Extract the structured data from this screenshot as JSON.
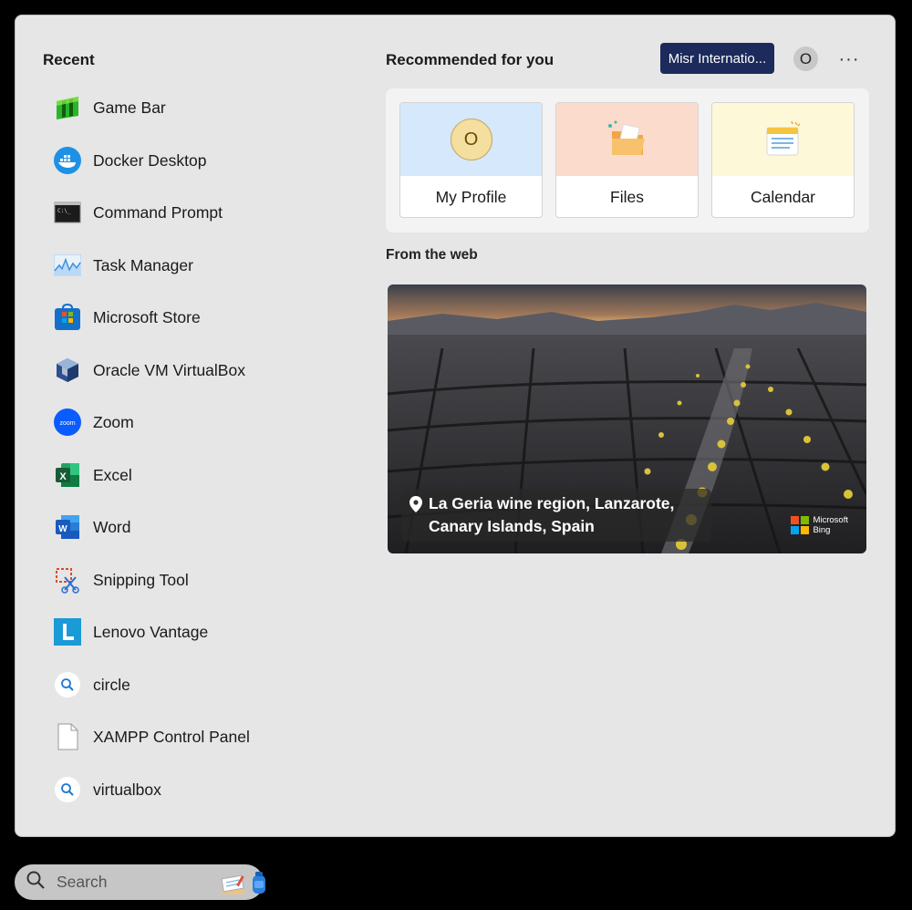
{
  "recent": {
    "title": "Recent",
    "items": [
      {
        "label": "Game Bar",
        "icon": "game-bar-icon"
      },
      {
        "label": "Docker Desktop",
        "icon": "docker-icon"
      },
      {
        "label": "Command Prompt",
        "icon": "command-prompt-icon"
      },
      {
        "label": "Task Manager",
        "icon": "task-manager-icon"
      },
      {
        "label": "Microsoft Store",
        "icon": "microsoft-store-icon"
      },
      {
        "label": "Oracle VM VirtualBox",
        "icon": "virtualbox-icon"
      },
      {
        "label": "Zoom",
        "icon": "zoom-icon"
      },
      {
        "label": "Excel",
        "icon": "excel-icon"
      },
      {
        "label": "Word",
        "icon": "word-icon"
      },
      {
        "label": "Snipping Tool",
        "icon": "snipping-tool-icon"
      },
      {
        "label": "Lenovo Vantage",
        "icon": "lenovo-vantage-icon"
      },
      {
        "label": "circle",
        "icon": "search-result-icon"
      },
      {
        "label": "XAMPP Control Panel",
        "icon": "file-icon"
      },
      {
        "label": "virtualbox",
        "icon": "search-result-icon"
      }
    ]
  },
  "recommended": {
    "title": "Recommended for you",
    "account_label": "Misr Internatio...",
    "avatar_letter": "O",
    "more_label": "···",
    "cards": [
      {
        "label": "My Profile",
        "icon": "profile-icon",
        "avatar_letter": "O",
        "bg": "#d6e8fb"
      },
      {
        "label": "Files",
        "icon": "files-icon",
        "bg": "#fbdccc"
      },
      {
        "label": "Calendar",
        "icon": "calendar-icon",
        "bg": "#fdf9d8"
      }
    ]
  },
  "web": {
    "title": "From the web",
    "caption_line1": "La Geria wine region, Lanzarote,",
    "caption_line2": "Canary Islands, Spain",
    "bing_line1": "Microsoft",
    "bing_line2": "Bing"
  },
  "taskbar": {
    "search_placeholder": "Search"
  },
  "colors": {
    "panel_bg": "#e6e6e6",
    "account_bg": "#1c2a5c",
    "taskbar_search_bg": "#c6c6c6"
  }
}
